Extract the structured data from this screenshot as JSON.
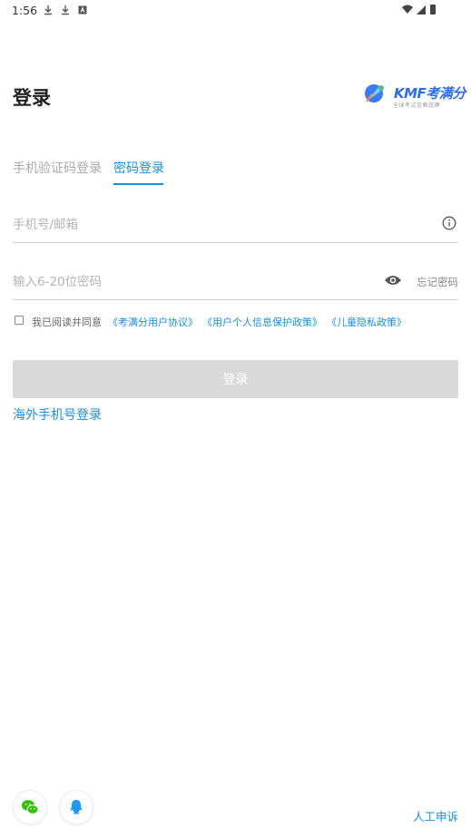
{
  "status_bar": {
    "time": "1:56",
    "left_icons": [
      "download-icon",
      "download-icon",
      "app-notification-icon"
    ],
    "right_icons": [
      "wifi-icon",
      "signal-icon",
      "battery-icon"
    ]
  },
  "header": {
    "title": "登录",
    "brand_name": "KMF考满分",
    "brand_slogan": "全球考试信赖品牌"
  },
  "tabs": [
    {
      "label": "手机验证码登录",
      "active": false
    },
    {
      "label": "密码登录",
      "active": true
    }
  ],
  "form": {
    "account_placeholder": "手机号/邮箱",
    "account_value": "",
    "password_placeholder": "输入6-20位密码",
    "password_value": "",
    "forgot_label": "忘记密码"
  },
  "agreement": {
    "checked": false,
    "prefix": "我已阅读并同意",
    "user_agreement": "《考满分用户协议》",
    "privacy_policy": "《用户个人信息保护政策》",
    "child_policy": "《儿童隐私政策》"
  },
  "login_label": "登录",
  "overseas_label": "海外手机号登录",
  "bottom": {
    "social": [
      "wechat-icon",
      "qq-icon"
    ],
    "appeal_label": "人工申诉"
  },
  "colors": {
    "accent": "#1a8fe0",
    "button_disabled": "#d9d9d9",
    "wechat": "#2dc100",
    "qq": "#1e9bf0"
  }
}
